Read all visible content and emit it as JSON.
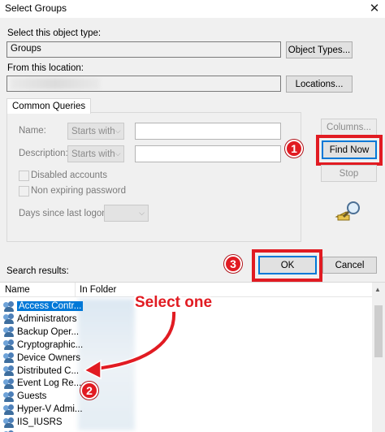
{
  "window": {
    "title": "Select Groups",
    "close_glyph": "✕"
  },
  "object_type": {
    "label": "Select this object type:",
    "value": "Groups",
    "button": "Object Types..."
  },
  "location": {
    "label": "From this location:",
    "value": "",
    "button": "Locations..."
  },
  "queries": {
    "tab": "Common Queries",
    "name_label": "Name:",
    "name_mode": "Starts with",
    "description_label": "Description:",
    "description_mode": "Starts with",
    "disabled_accounts": "Disabled accounts",
    "non_expiring": "Non expiring password",
    "days_label": "Days since last logon:"
  },
  "side_buttons": {
    "columns": "Columns...",
    "find_now": "Find Now",
    "stop": "Stop"
  },
  "search_results_label": "Search results:",
  "dialog_buttons": {
    "ok": "OK",
    "cancel": "Cancel"
  },
  "results": {
    "columns": [
      "Name",
      "In Folder"
    ],
    "rows": [
      "Access Contr...",
      "Administrators",
      "Backup Oper...",
      "Cryptographic...",
      "Device Owners",
      "Distributed C...",
      "Event Log Re...",
      "Guests",
      "Hyper-V Admi...",
      "IIS_IUSRS",
      "..."
    ],
    "selected_index": 0
  },
  "annotations": {
    "step1": "1",
    "step2": "2",
    "step3": "3",
    "select_one": "Select one",
    "color": "#e11b22"
  }
}
